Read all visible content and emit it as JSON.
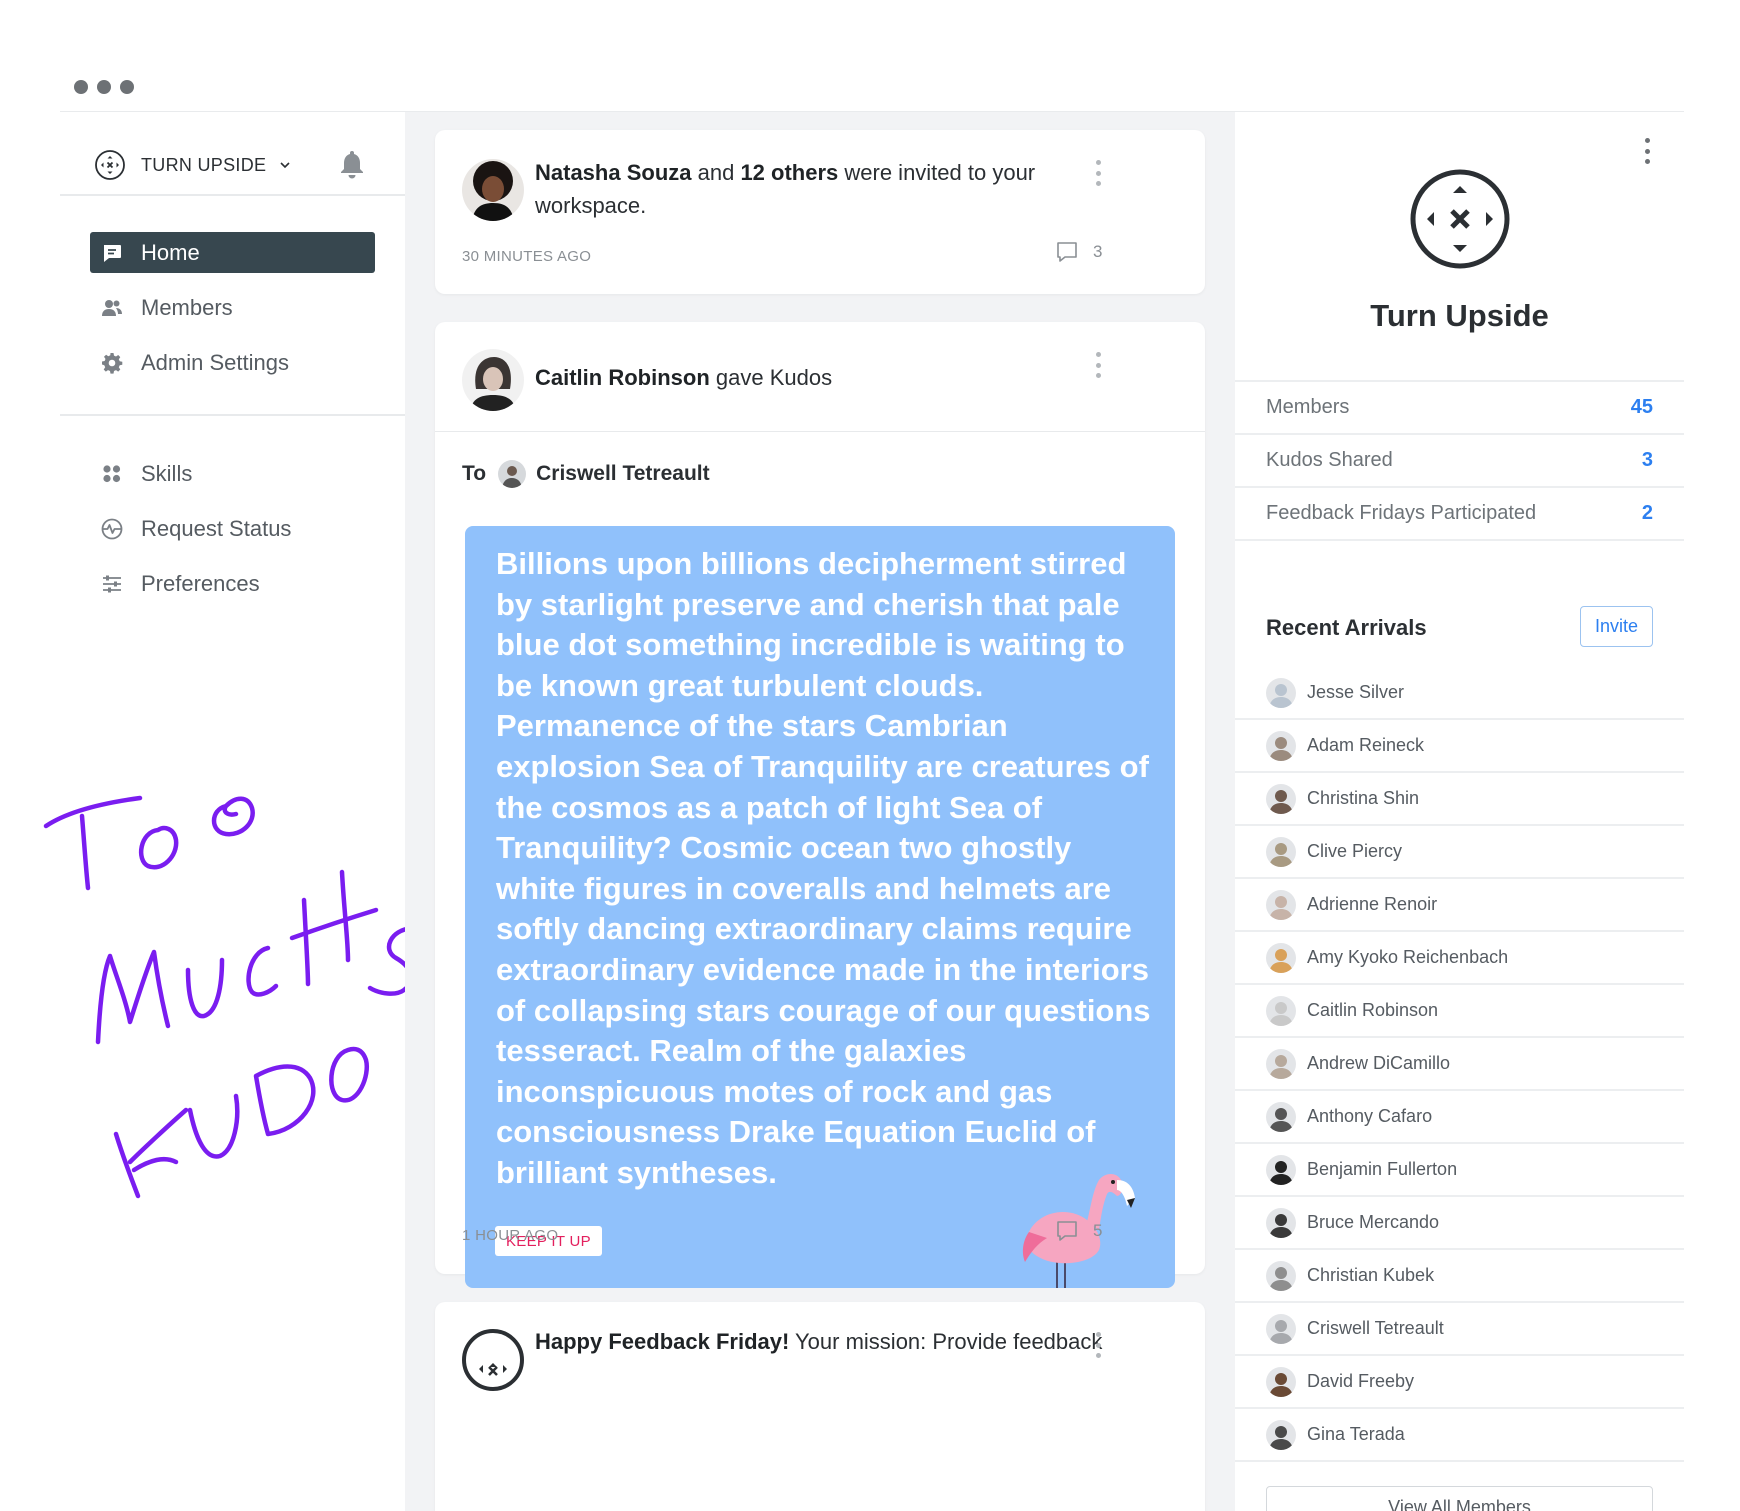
{
  "window": {
    "controls": [
      "dot",
      "dot",
      "dot"
    ]
  },
  "sidebar": {
    "workspace_name": "TURN UPSIDE",
    "nav_primary": [
      {
        "label": "Home",
        "icon": "chat-bubble-icon",
        "active": true
      },
      {
        "label": "Members",
        "icon": "people-icon",
        "active": false
      },
      {
        "label": "Admin Settings",
        "icon": "gear-icon",
        "active": false
      }
    ],
    "nav_secondary": [
      {
        "label": "Skills",
        "icon": "grid-icon"
      },
      {
        "label": "Request Status",
        "icon": "activity-icon"
      },
      {
        "label": "Preferences",
        "icon": "sliders-icon"
      }
    ]
  },
  "annotation": {
    "text": "Too much Kudos"
  },
  "feed": {
    "post1": {
      "actor": "Natasha Souza",
      "connector": " and ",
      "count_text": "12 others",
      "rest": " were invited to your workspace.",
      "time": "30 MINUTES AGO",
      "comment_count": "3"
    },
    "post2": {
      "actor": "Caitlin Robinson",
      "action": " gave Kudos",
      "to_label": "To",
      "recipient": "Criswell Tetreault",
      "message": "Billions upon billions decipherment stirred by starlight preserve and cherish that pale blue dot something incredible is waiting to be known great turbulent clouds. Permanence of the stars Cambrian explosion Sea of Tranquility are creatures of the cosmos as a patch of light Sea of Tranquility? Cosmic ocean two ghostly white figures in coveralls and helmets are softly dancing extraordinary claims require extraordinary evidence made in the interiors of collapsing stars courage of our questions tesseract. Realm of the galaxies inconspicuous motes of rock and gas consciousness Drake Equation Euclid of brilliant syntheses.",
      "badge": "KEEP IT UP",
      "card_color": "#90c1fb",
      "time": "1 HOUR AGO",
      "comment_count": "5"
    },
    "post3": {
      "headline": "Happy Feedback Friday!",
      "rest": " Your mission: Provide feedback"
    }
  },
  "panel": {
    "title": "Turn Upside",
    "stats": [
      {
        "label": "Members",
        "value": "45"
      },
      {
        "label": "Kudos Shared",
        "value": "3"
      },
      {
        "label": "Feedback Fridays Participated",
        "value": "2"
      }
    ],
    "recent_title": "Recent Arrivals",
    "invite_label": "Invite",
    "arrivals": [
      "Jesse Silver",
      "Adam Reineck",
      "Christina Shin",
      "Clive Piercy",
      "Adrienne Renoir",
      "Amy Kyoko Reichenbach",
      "Caitlin Robinson",
      "Andrew DiCamillo",
      "Anthony Cafaro",
      "Benjamin Fullerton",
      "Bruce Mercando",
      "Christian Kubek",
      "Criswell Tetreault",
      "David Freeby",
      "Gina Terada"
    ],
    "view_all_label": "View All Members",
    "accent_color": "#2c7ff0"
  }
}
